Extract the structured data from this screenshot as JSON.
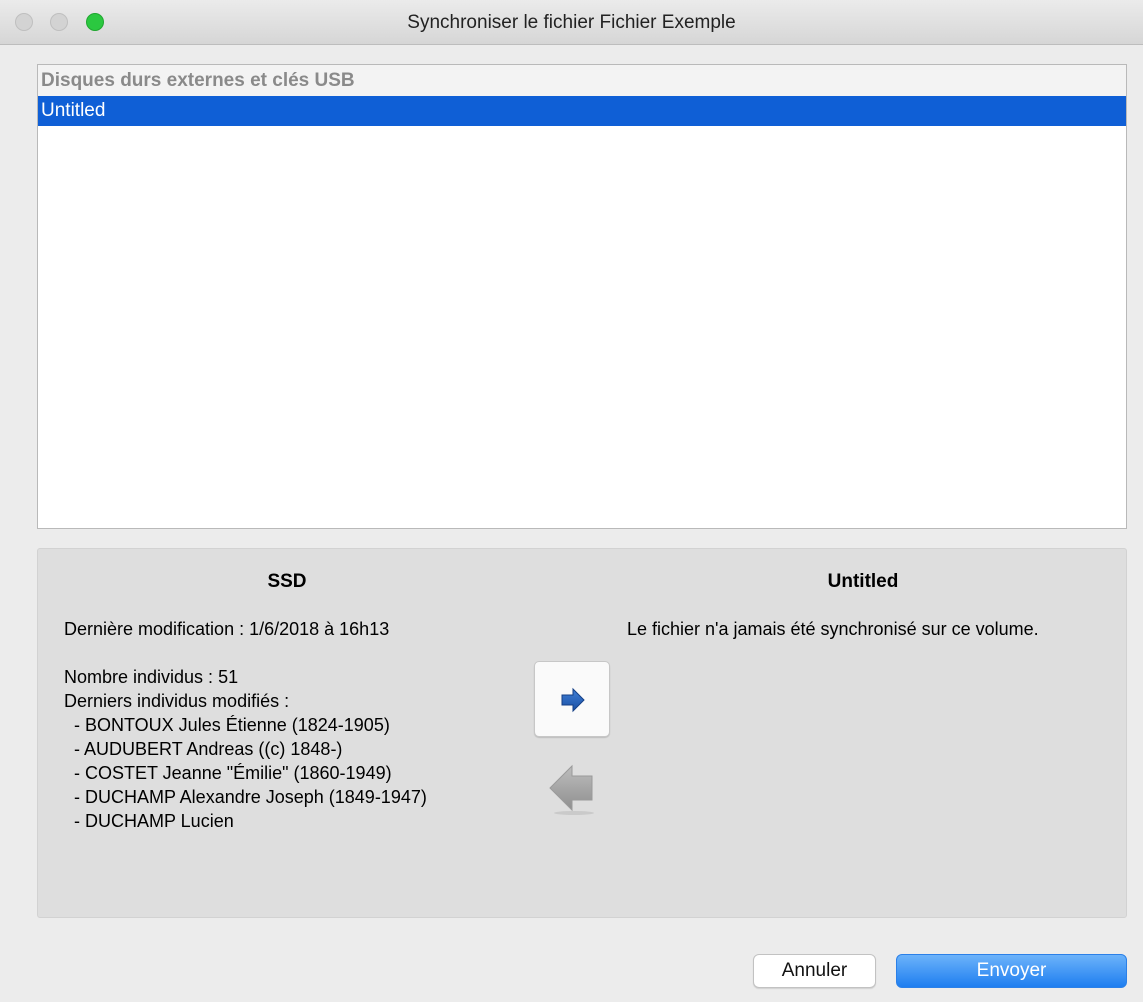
{
  "window": {
    "title": "Synchroniser le fichier Fichier Exemple"
  },
  "volumes": {
    "header": "Disques durs externes et clés USB",
    "items": [
      {
        "label": "Untitled",
        "selected": true
      }
    ]
  },
  "source": {
    "title": "SSD",
    "last_modified": "Dernière modification : 1/6/2018 à 16h13",
    "count": "Nombre individus : 51",
    "recent_heading": "Derniers individus modifiés :",
    "recent": [
      "- BONTOUX Jules Étienne (1824-1905)",
      "- AUDUBERT Andreas ((c) 1848-)",
      "- COSTET Jeanne \"Émilie\" (1860-1949)",
      "- DUCHAMP Alexandre Joseph (1849-1947)",
      "- DUCHAMP Lucien"
    ]
  },
  "destination": {
    "title": "Untitled",
    "status": "Le fichier n'a jamais été synchronisé sur ce volume."
  },
  "actions": {
    "cancel_label": "Annuler",
    "send_label": "Envoyer"
  },
  "icons": {
    "sync_right": "arrow-right-icon",
    "sync_left": "arrow-left-icon"
  },
  "colors": {
    "selection": "#0f5fd6",
    "primary_button": "#1e7ef0",
    "arrow_active": "#1f5fb8",
    "arrow_inactive": "#a8a8a8"
  }
}
